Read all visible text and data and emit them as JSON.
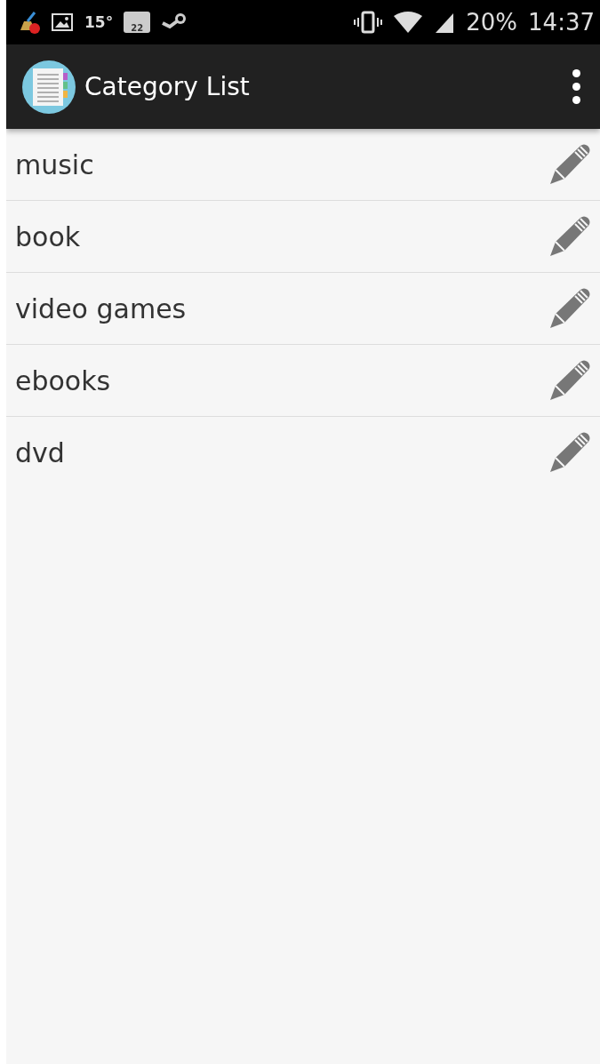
{
  "status_bar": {
    "temperature": "15°",
    "badge": "22",
    "battery": "20%",
    "time": "14:37"
  },
  "app_bar": {
    "title": "Category List"
  },
  "categories": [
    {
      "name": "music"
    },
    {
      "name": "book"
    },
    {
      "name": "video games"
    },
    {
      "name": "ebooks"
    },
    {
      "name": "dvd"
    }
  ]
}
